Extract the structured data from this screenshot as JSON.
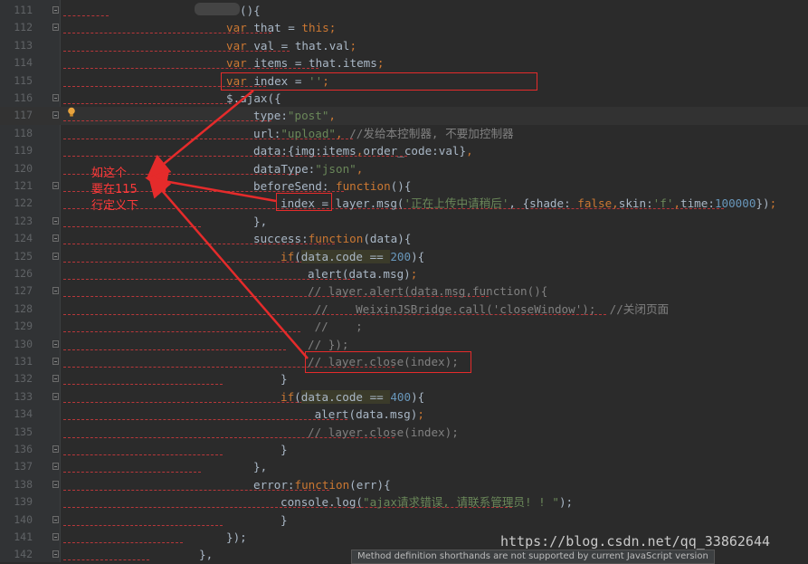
{
  "editor": {
    "lines": [
      {
        "n": "111",
        "indent": 0,
        "segs": [
          [
            "(){",
            "fn"
          ]
        ],
        "ul": 120
      },
      {
        "n": "112",
        "indent": 0,
        "segs": [
          [
            "var ",
            "kw"
          ],
          [
            "that = ",
            "fn"
          ],
          [
            "this",
            "kw"
          ],
          [
            ";",
            "kw"
          ]
        ],
        "ul": 300
      },
      {
        "n": "113",
        "indent": 0,
        "segs": [
          [
            "var ",
            "kw"
          ],
          [
            "val = that.val",
            ""
          ],
          [
            ";",
            "kw"
          ]
        ],
        "ul": 320
      },
      {
        "n": "114",
        "indent": 0,
        "segs": [
          [
            "var ",
            "kw"
          ],
          [
            "items = that.items",
            ""
          ],
          [
            ";",
            "kw"
          ]
        ],
        "ul": 352
      },
      {
        "n": "115",
        "indent": 0,
        "segs": [
          [
            "var ",
            "kw"
          ],
          [
            "index = ",
            ""
          ],
          [
            "''",
            "str"
          ],
          [
            ";",
            "kw"
          ]
        ],
        "ul": 294
      },
      {
        "n": "116",
        "indent": 0,
        "segs": [
          [
            "$.ajax({",
            ""
          ]
        ],
        "ul": 256
      },
      {
        "n": "117",
        "indent": 1,
        "segs": [
          [
            "type:",
            ""
          ],
          [
            "\"post\"",
            "str"
          ],
          [
            ",",
            "kw"
          ]
        ],
        "ul": 300
      },
      {
        "n": "118",
        "indent": 1,
        "segs": [
          [
            "url:",
            ""
          ],
          [
            "\"upload\"",
            "str"
          ],
          [
            ", ",
            "kw"
          ],
          [
            "//发给本控制器, 不要加控制器",
            "com"
          ]
        ],
        "ul": 390
      },
      {
        "n": "119",
        "indent": 1,
        "segs": [
          [
            "data:{img:items",
            ""
          ],
          [
            ",",
            "kw"
          ],
          [
            "order_code:val}",
            ""
          ],
          [
            ",",
            "kw"
          ]
        ],
        "ul": 450
      },
      {
        "n": "120",
        "indent": 1,
        "segs": [
          [
            "dataType:",
            ""
          ],
          [
            "\"json\"",
            "str"
          ],
          [
            ",",
            "kw"
          ]
        ],
        "ul": 330
      },
      {
        "n": "121",
        "indent": 1,
        "segs": [
          [
            "beforeSend: ",
            ""
          ],
          [
            "function",
            "kw"
          ],
          [
            "(){",
            ""
          ]
        ],
        "ul": 380
      },
      {
        "n": "122",
        "indent": 2,
        "segs": [
          [
            "index = layer.msg(",
            ""
          ],
          [
            "'正在上传中请稍后'",
            "str"
          ],
          [
            ", {shade: ",
            ""
          ],
          [
            "false",
            "kw"
          ],
          [
            ",",
            "kw"
          ],
          [
            "skin:",
            ""
          ],
          [
            "'f'",
            "str"
          ],
          [
            ",",
            "kw"
          ],
          [
            "time:",
            ""
          ],
          [
            "100000",
            "num"
          ],
          [
            "})",
            ""
          ],
          [
            ";",
            "kw"
          ]
        ],
        "ul": 800
      },
      {
        "n": "123",
        "indent": 1,
        "segs": [
          [
            "},",
            ""
          ]
        ],
        "ul": 222
      },
      {
        "n": "124",
        "indent": 1,
        "segs": [
          [
            "success:",
            ""
          ],
          [
            "function",
            "kw"
          ],
          [
            "(data){",
            ""
          ]
        ],
        "ul": 370
      },
      {
        "n": "125",
        "indent": 2,
        "segs": [
          [
            "if",
            "kw"
          ],
          [
            "(",
            ""
          ],
          [
            "data.code == ",
            ""
          ],
          [
            "200",
            "num"
          ],
          [
            "){",
            ""
          ]
        ],
        "ul": 400
      },
      {
        "n": "126",
        "indent": 3,
        "segs": [
          [
            "alert(data.msg)",
            ""
          ],
          [
            ";",
            "kw"
          ]
        ],
        "ul": 392
      },
      {
        "n": "127",
        "indent": 3,
        "segs": [
          [
            "// layer.alert(data.msg,function(){",
            "com"
          ]
        ],
        "ul": 540
      },
      {
        "n": "128",
        "indent": 3,
        "segs": [
          [
            " //    WeixinJSBridge.call('closeWindow');  //关闭页面",
            "com"
          ]
        ],
        "ul": 670
      },
      {
        "n": "129",
        "indent": 3,
        "segs": [
          [
            " //    ;",
            "com"
          ]
        ],
        "ul": 332
      },
      {
        "n": "130",
        "indent": 3,
        "segs": [
          [
            "// });",
            "com"
          ]
        ],
        "ul": 316
      },
      {
        "n": "131",
        "indent": 3,
        "segs": [
          [
            "// layer.close(index);",
            "com"
          ]
        ],
        "ul": 436
      },
      {
        "n": "132",
        "indent": 2,
        "segs": [
          [
            "}",
            ""
          ]
        ],
        "ul": 246
      },
      {
        "n": "133",
        "indent": 2,
        "segs": [
          [
            "if",
            "kw"
          ],
          [
            "(",
            ""
          ],
          [
            "data.code == ",
            ""
          ],
          [
            "400",
            "num"
          ],
          [
            "){",
            ""
          ]
        ],
        "ul": 400
      },
      {
        "n": "134",
        "indent": 3,
        "segs": [
          [
            " alert(data.msg)",
            ""
          ],
          [
            ";",
            "kw"
          ]
        ],
        "ul": 384
      },
      {
        "n": "135",
        "indent": 3,
        "segs": [
          [
            "// layer.close(index);",
            "com"
          ]
        ],
        "ul": 436
      },
      {
        "n": "136",
        "indent": 2,
        "segs": [
          [
            "}",
            ""
          ]
        ],
        "ul": 246
      },
      {
        "n": "137",
        "indent": 1,
        "segs": [
          [
            "},",
            ""
          ]
        ],
        "ul": 222
      },
      {
        "n": "138",
        "indent": 1,
        "segs": [
          [
            "error:",
            ""
          ],
          [
            "function",
            "kw"
          ],
          [
            "(err){",
            ""
          ]
        ],
        "ul": 364
      },
      {
        "n": "139",
        "indent": 2,
        "segs": [
          [
            "console.log(",
            ""
          ],
          [
            "\"ajax请求错误, 请联系管理员! ! \"",
            "str"
          ],
          [
            ");",
            ""
          ]
        ],
        "ul": 566
      },
      {
        "n": "140",
        "indent": 2,
        "segs": [
          [
            "}",
            ""
          ]
        ],
        "ul": 246
      },
      {
        "n": "141",
        "indent": 0,
        "segs": [
          [
            "});",
            ""
          ]
        ],
        "ul": 202
      },
      {
        "n": "142",
        "indent": -1,
        "segs": [
          [
            "},",
            ""
          ]
        ],
        "ul": 165
      }
    ]
  },
  "annotation": {
    "note_text": "如这个\n要在115\n行定义下"
  },
  "watermark": "https://blog.csdn.net/qq_33862644",
  "status_tooltip": "Method definition shorthands are not supported by current JavaScript version",
  "colors": {
    "annotation": "#e52b2b",
    "background": "#2b2b2b",
    "gutter": "#313335"
  }
}
